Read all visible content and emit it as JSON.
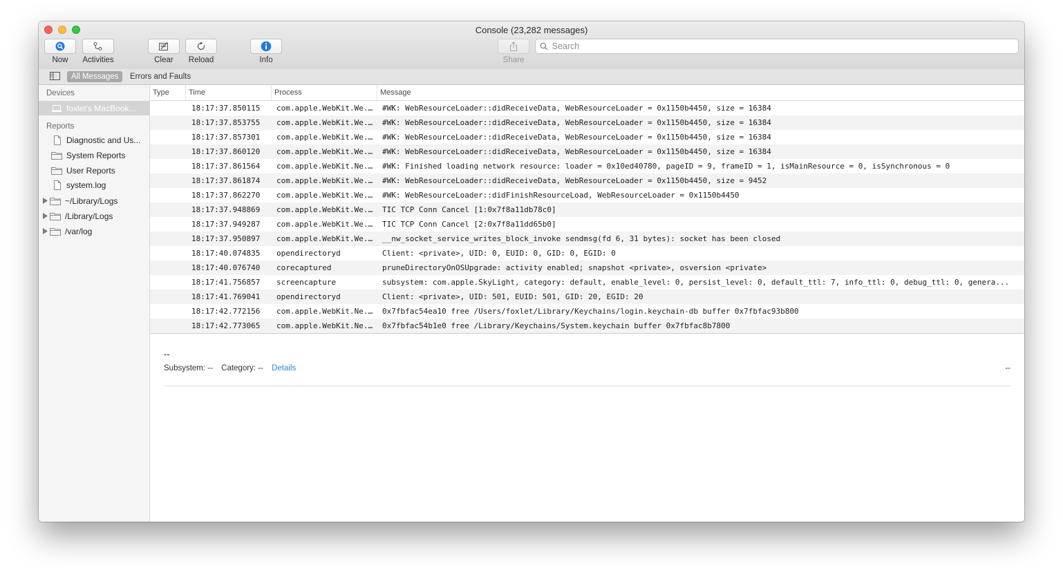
{
  "window": {
    "title": "Console (23,282 messages)"
  },
  "toolbar": {
    "now": "Now",
    "activities": "Activities",
    "clear": "Clear",
    "reload": "Reload",
    "info": "Info",
    "share": "Share",
    "search_placeholder": "Search"
  },
  "filter": {
    "all_messages": "All Messages",
    "errors_and_faults": "Errors and Faults"
  },
  "sidebar": {
    "devices_header": "Devices",
    "device": "foxlet's MacBook...",
    "reports_header": "Reports",
    "reports": [
      {
        "label": "Diagnostic and Us...",
        "icon": "document-icon"
      },
      {
        "label": "System Reports",
        "icon": "folder-icon"
      },
      {
        "label": "User Reports",
        "icon": "folder-icon"
      },
      {
        "label": "system.log",
        "icon": "document-icon"
      }
    ],
    "folders": [
      {
        "label": "~/Library/Logs"
      },
      {
        "label": "/Library/Logs"
      },
      {
        "label": "/var/log"
      }
    ]
  },
  "table": {
    "columns": [
      "Type",
      "Time",
      "Process",
      "Message"
    ],
    "rows": [
      {
        "time": "18:17:37.850115",
        "process": "com.apple.WebKit.We...",
        "message": "#WK: WebResourceLoader::didReceiveData, WebResourceLoader = 0x1150b4450, size = 16384"
      },
      {
        "time": "18:17:37.853755",
        "process": "com.apple.WebKit.We...",
        "message": "#WK: WebResourceLoader::didReceiveData, WebResourceLoader = 0x1150b4450, size = 16384"
      },
      {
        "time": "18:17:37.857301",
        "process": "com.apple.WebKit.We...",
        "message": "#WK: WebResourceLoader::didReceiveData, WebResourceLoader = 0x1150b4450, size = 16384"
      },
      {
        "time": "18:17:37.860120",
        "process": "com.apple.WebKit.We...",
        "message": "#WK: WebResourceLoader::didReceiveData, WebResourceLoader = 0x1150b4450, size = 16384"
      },
      {
        "time": "18:17:37.861564",
        "process": "com.apple.WebKit.Ne...",
        "message": "#WK: Finished loading network resource: loader = 0x10ed40780, pageID = 9, frameID = 1, isMainResource = 0, isSynchronous = 0"
      },
      {
        "time": "18:17:37.861874",
        "process": "com.apple.WebKit.We...",
        "message": "#WK: WebResourceLoader::didReceiveData, WebResourceLoader = 0x1150b4450, size = 9452"
      },
      {
        "time": "18:17:37.862270",
        "process": "com.apple.WebKit.We...",
        "message": "#WK: WebResourceLoader::didFinishResourceLoad, WebResourceLoader = 0x1150b4450"
      },
      {
        "time": "18:17:37.948869",
        "process": "com.apple.WebKit.We...",
        "message": "TIC TCP Conn Cancel [1:0x7f8a11db78c0]"
      },
      {
        "time": "18:17:37.949287",
        "process": "com.apple.WebKit.We...",
        "message": "TIC TCP Conn Cancel [2:0x7f8a11dd65b0]"
      },
      {
        "time": "18:17:37.950897",
        "process": "com.apple.WebKit.We...",
        "message": "__nw_socket_service_writes_block_invoke sendmsg(fd 6, 31 bytes): socket has been closed"
      },
      {
        "time": "18:17:40.074835",
        "process": "opendirectoryd",
        "message": "Client: <private>, UID: 0, EUID: 0, GID: 0, EGID: 0"
      },
      {
        "time": "18:17:40.076740",
        "process": "corecaptured",
        "message": "pruneDirectoryOnOSUpgrade: activity enabled; snapshot <private>, osversion <private>"
      },
      {
        "time": "18:17:41.756857",
        "process": "screencapture",
        "message": "subsystem: com.apple.SkyLight, category: default, enable_level: 0, persist_level: 0, default_ttl: 7, info_ttl: 0, debug_ttl: 0, genera..."
      },
      {
        "time": "18:17:41.769041",
        "process": "opendirectoryd",
        "message": "Client: <private>, UID: 501, EUID: 501, GID: 20, EGID: 20"
      },
      {
        "time": "18:17:42.772156",
        "process": "com.apple.WebKit.Ne...",
        "message": "0x7fbfac54ea10 free /Users/foxlet/Library/Keychains/login.keychain-db buffer 0x7fbfac93b800"
      },
      {
        "time": "18:17:42.773065",
        "process": "com.apple.WebKit.Ne...",
        "message": "0x7fbfac54b1e0 free /Library/Keychains/System.keychain buffer 0x7fbfac8b7800"
      }
    ]
  },
  "detail": {
    "title": "--",
    "subsystem": "Subsystem: --",
    "category": "Category: --",
    "details_link": "Details",
    "right": "--"
  }
}
